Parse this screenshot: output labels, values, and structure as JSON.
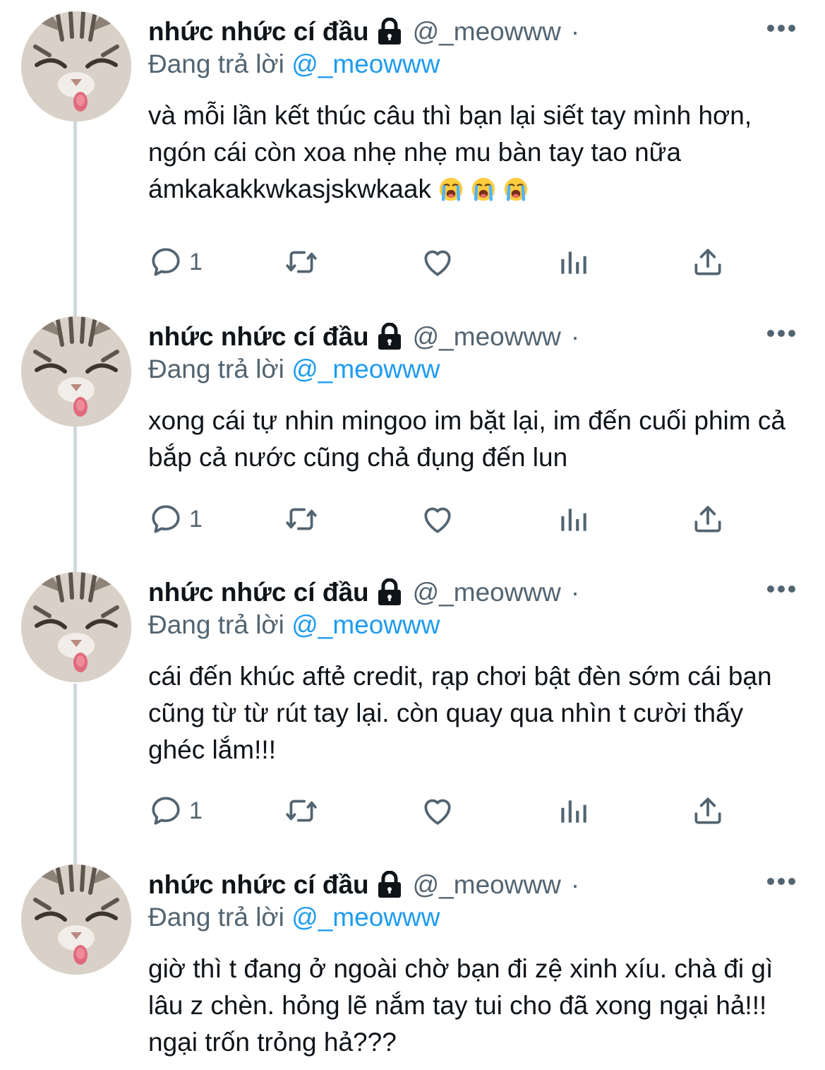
{
  "tweets": [
    {
      "display_name": "nhức nhức cí đầu",
      "handle": "@_meowww",
      "separator": "·",
      "replying_prefix": "Đang trả lời",
      "replying_to": "@_meowww",
      "text": "và mỗi lần kết thúc câu thì bạn lại siết tay mình hơn, ngón cái còn xoa nhẹ nhẹ mu bàn tay tao nữa ámkakakkwkasjskwkaak",
      "emoji": [
        "loudly-crying-face",
        "loudly-crying-face",
        "loudly-crying-face"
      ],
      "reply_count": "1"
    },
    {
      "display_name": "nhức nhức cí đầu",
      "handle": "@_meowww",
      "separator": "·",
      "replying_prefix": "Đang trả lời",
      "replying_to": "@_meowww",
      "text": "xong cái tự nhin mingoo im bặt lại, im đến cuối phim cả bắp cả nước cũng chả đụng đến lun",
      "reply_count": "1"
    },
    {
      "display_name": "nhức nhức cí đầu",
      "handle": "@_meowww",
      "separator": "·",
      "replying_prefix": "Đang trả lời",
      "replying_to": "@_meowww",
      "text": "cái đến khúc aftẻ credit, rạp chơi bật đèn sớm cái bạn cũng từ từ rút tay lại. còn quay qua nhìn t cười thấy ghéc lắm!!!",
      "reply_count": "1"
    },
    {
      "display_name": "nhức nhức cí đầu",
      "handle": "@_meowww",
      "separator": "·",
      "replying_prefix": "Đang trả lời",
      "replying_to": "@_meowww",
      "text": "giờ thì t đang ở ngoài chờ bạn đi zệ xinh xíu. chà đi gì lâu z chèn. hỏng lẽ nắm tay tui cho đã xong ngại hả!!! ngại trốn trỏng hả???"
    }
  ],
  "icons": {
    "lock": "lock-icon",
    "more": "more-options-icon",
    "reply": "reply-icon",
    "retweet": "retweet-icon",
    "like": "heart-icon",
    "views": "analytics-icon",
    "share": "share-icon"
  },
  "colors": {
    "accent": "#1d9bf0",
    "secondary_text": "#536471",
    "primary_text": "#0f1419",
    "thread_line": "#cfd9de"
  }
}
